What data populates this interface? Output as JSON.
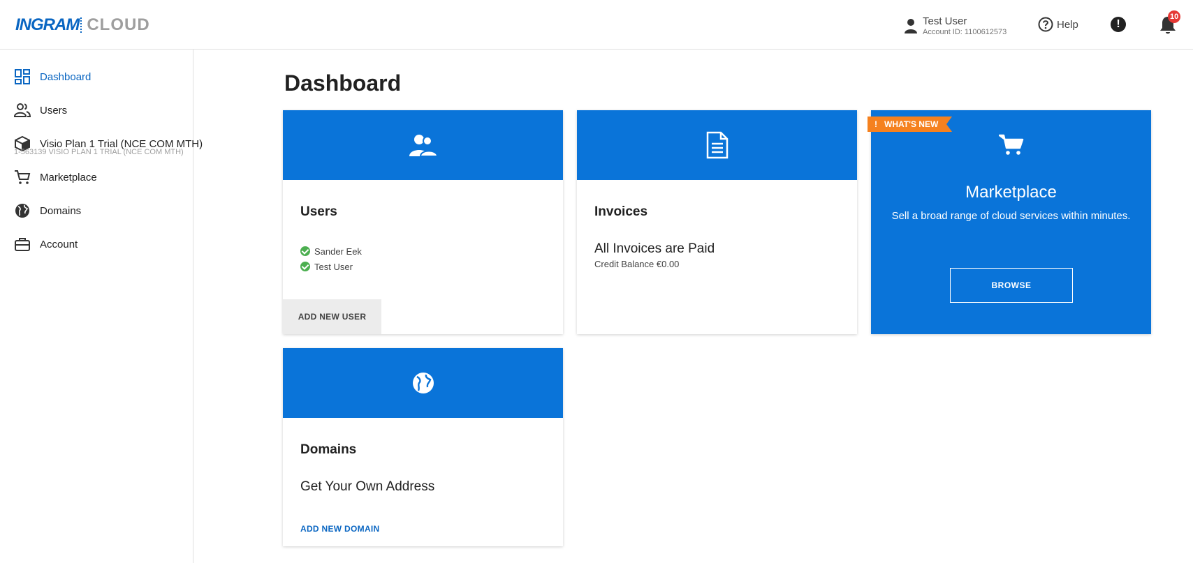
{
  "brand": {
    "name_part1": "INGRAM",
    "name_part2": "CLOUD",
    "primary_color": "#0a74d9",
    "accent_color": "#f5811f"
  },
  "header": {
    "user_name": "Test User",
    "account_id": "Account ID: 1100612573",
    "help_label": "Help",
    "notifications_count": "10",
    "alert_icon": "exclamation-icon",
    "bell_icon": "bell-icon"
  },
  "sidebar": {
    "items": [
      {
        "label": "Dashboard",
        "icon": "dashboard-icon",
        "active": true
      },
      {
        "label": "Users",
        "icon": "users-icon"
      },
      {
        "label": "Visio Plan 1 Trial (NCE COM MTH)",
        "sub": "1-563139 VISIO PLAN 1 TRIAL (NCE COM MTH)",
        "icon": "box-icon"
      },
      {
        "label": "Marketplace",
        "icon": "cart-icon"
      },
      {
        "label": "Domains",
        "icon": "globe-icon"
      },
      {
        "label": "Account",
        "icon": "briefcase-icon"
      }
    ]
  },
  "main": {
    "title": "Dashboard",
    "users_card": {
      "title": "Users",
      "users": [
        "Sander Eek",
        "Test User"
      ],
      "action": "ADD NEW USER"
    },
    "invoices_card": {
      "title": "Invoices",
      "status": "All Invoices are Paid",
      "balance": "Credit Balance €0.00"
    },
    "marketplace_card": {
      "ribbon": "WHAT'S NEW",
      "title": "Marketplace",
      "description": "Sell a broad range of cloud services within minutes.",
      "action": "BROWSE"
    },
    "domains_card": {
      "title": "Domains",
      "subtitle": "Get Your Own Address",
      "action": "ADD NEW DOMAIN"
    }
  }
}
